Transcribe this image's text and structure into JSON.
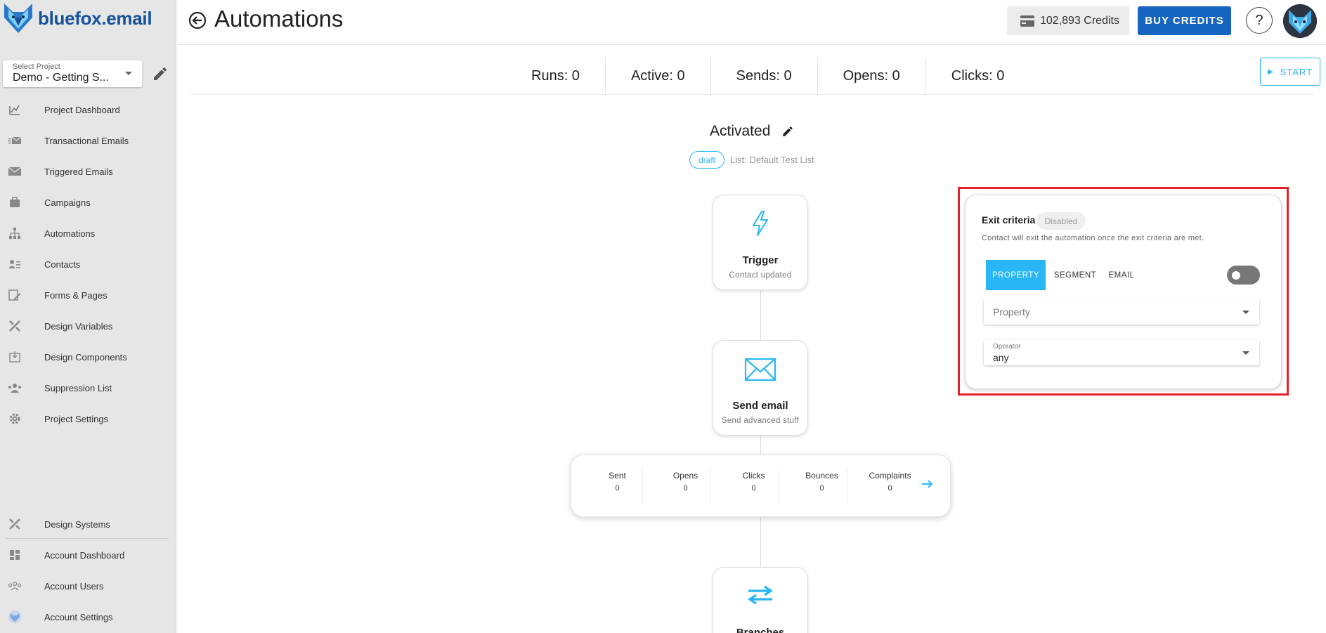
{
  "brand": {
    "name": "bluefox.email"
  },
  "project_select": {
    "label": "Select Project",
    "value": "Demo - Getting S..."
  },
  "sidebar": {
    "items": [
      {
        "label": "Project Dashboard",
        "icon": "chart-icon"
      },
      {
        "label": "Transactional Emails",
        "icon": "transactional-email-icon"
      },
      {
        "label": "Triggered Emails",
        "icon": "mail-icon"
      },
      {
        "label": "Campaigns",
        "icon": "campaign-icon"
      },
      {
        "label": "Automations",
        "icon": "sitemap-icon"
      },
      {
        "label": "Contacts",
        "icon": "contacts-icon"
      },
      {
        "label": "Forms & Pages",
        "icon": "form-edit-icon"
      },
      {
        "label": "Design Variables",
        "icon": "design-tools-icon"
      },
      {
        "label": "Design Components",
        "icon": "component-icon"
      },
      {
        "label": "Suppression List",
        "icon": "suppression-icon"
      },
      {
        "label": "Project Settings",
        "icon": "gear-icon"
      }
    ],
    "bottom_items": [
      {
        "label": "Design Systems",
        "icon": "design-tools-icon"
      },
      {
        "label": "Account Dashboard",
        "icon": "dashboard-icon"
      },
      {
        "label": "Account Users",
        "icon": "users-icon"
      },
      {
        "label": "Account Settings",
        "icon": "fox-icon"
      }
    ]
  },
  "header": {
    "title": "Automations",
    "credits": "102,893 Credits",
    "buy_label": "BUY CREDITS",
    "help_label": "?"
  },
  "stats": [
    {
      "text": "Runs: 0"
    },
    {
      "text": "Active: 0"
    },
    {
      "text": "Sends: 0"
    },
    {
      "text": "Opens: 0"
    },
    {
      "text": "Clicks: 0"
    }
  ],
  "start_label": "START",
  "flow": {
    "title": "Activated",
    "status": "draft",
    "list": "List: Default Test List",
    "trigger": {
      "title": "Trigger",
      "subtitle": "Contact updated"
    },
    "send": {
      "title": "Send email",
      "subtitle": "Send advanced stuff"
    },
    "branches": {
      "title": "Branches"
    },
    "metrics": [
      {
        "label": "Sent",
        "value": "0"
      },
      {
        "label": "Opens",
        "value": "0"
      },
      {
        "label": "Clicks",
        "value": "0"
      },
      {
        "label": "Bounces",
        "value": "0"
      },
      {
        "label": "Complaints",
        "value": "0"
      }
    ]
  },
  "exit_criteria": {
    "title": "Exit criteria",
    "badge": "Disabled",
    "description": "Contact will exit the automation once the exit criteria are met.",
    "tabs": [
      "PROPERTY",
      "SEGMENT",
      "EMAIL"
    ],
    "property_placeholder": "Property",
    "operator_label": "Operator",
    "operator_value": "any",
    "enabled": false
  },
  "colors": {
    "accent": "#29b6f6",
    "primary": "#1565c0",
    "highlight": "#e8202a"
  }
}
